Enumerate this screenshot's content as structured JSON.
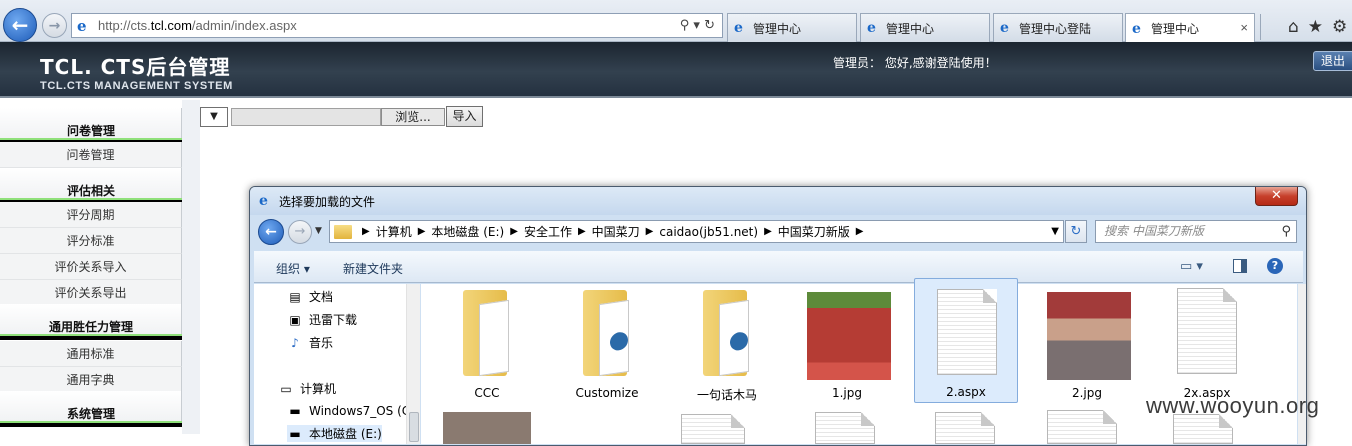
{
  "browser": {
    "url_prefix": "http://cts.",
    "url_domain": "tcl.com",
    "url_path": "/admin/index.aspx",
    "address_controls": "⚲ ▾ ↻",
    "tabs": [
      {
        "label": "管理中心",
        "active": false
      },
      {
        "label": "管理中心",
        "active": false
      },
      {
        "label": "管理中心登陆",
        "active": false
      },
      {
        "label": "管理中心",
        "active": true
      }
    ],
    "tab_close": "×",
    "toolbar_icons": [
      "home-icon",
      "favorites-star-icon",
      "tools-gear-icon"
    ]
  },
  "header": {
    "brand": "TCL. CTS后台管理",
    "brand_sub": "TCL.CTS MANAGEMENT SYSTEM",
    "welcome": "管理员： 您好,感谢登陆使用！",
    "logout": "退出"
  },
  "sidebar": {
    "sections": [
      {
        "title": "问卷管理",
        "items": [
          "问卷管理"
        ]
      },
      {
        "title": "评估相关",
        "items": [
          "评分周期",
          "评分标准",
          "评价关系导入",
          "评价关系导出"
        ]
      },
      {
        "title": "通用胜任力管理",
        "items": [
          "通用标准",
          "通用字典"
        ]
      },
      {
        "title": "系统管理",
        "items": []
      }
    ]
  },
  "import_row": {
    "select_value": "",
    "browse_label": "浏览...",
    "import_label": "导入"
  },
  "dialog": {
    "title": "选择要加载的文件",
    "close": "✕",
    "path": [
      "计算机",
      "本地磁盘 (E:)",
      "安全工作",
      "中国菜刀",
      "caidao(jb51.net)",
      "中国菜刀新版"
    ],
    "search_placeholder": "搜索 中国菜刀新版",
    "commands": {
      "organize": "组织 ▾",
      "new_folder": "新建文件夹"
    },
    "nav_items": [
      {
        "label": "文档",
        "icon": "documents-icon"
      },
      {
        "label": "迅雷下载",
        "icon": "downloads-icon"
      },
      {
        "label": "音乐",
        "icon": "music-icon"
      },
      {
        "label": "计算机",
        "icon": "computer-icon"
      },
      {
        "label": "Windows7_OS (C",
        "icon": "drive-icon"
      },
      {
        "label": "本地磁盘 (E:)",
        "icon": "drive-icon"
      }
    ],
    "files": [
      {
        "name": "CCC",
        "kind": "folder"
      },
      {
        "name": "Customize",
        "kind": "folder"
      },
      {
        "name": "一句话木马",
        "kind": "folder"
      },
      {
        "name": "1.jpg",
        "kind": "photo"
      },
      {
        "name": "2.aspx",
        "kind": "doc",
        "selected": true
      },
      {
        "name": "2.jpg",
        "kind": "photo"
      },
      {
        "name": "2x.aspx",
        "kind": "doc"
      }
    ]
  },
  "watermark": "www.wooyun.org"
}
